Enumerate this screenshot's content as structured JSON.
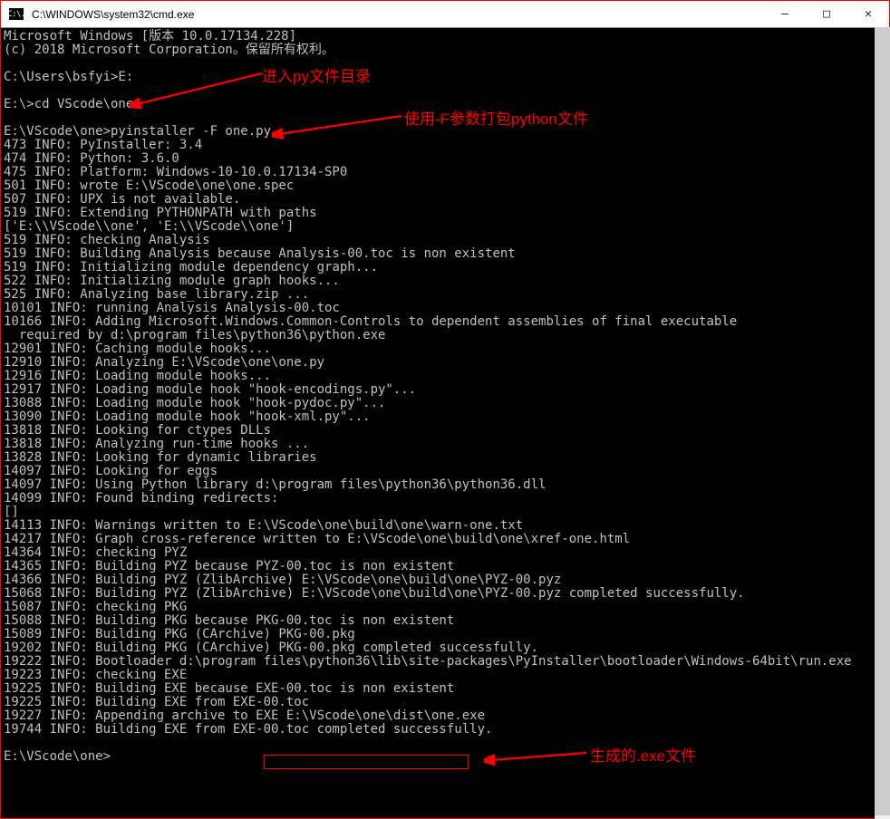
{
  "titlebar": {
    "icon_text": "C:\\.",
    "title": "C:\\WINDOWS\\system32\\cmd.exe"
  },
  "controls": {
    "minimize": "—",
    "maximize": "□",
    "close": "✕"
  },
  "terminal_lines": [
    "Microsoft Windows [版本 10.0.17134.228]",
    "(c) 2018 Microsoft Corporation。保留所有权利。",
    "",
    "C:\\Users\\bsfyi>E:",
    "",
    "E:\\>cd VScode\\one",
    "",
    "E:\\VScode\\one>pyinstaller -F one.py",
    "473 INFO: PyInstaller: 3.4",
    "474 INFO: Python: 3.6.0",
    "475 INFO: Platform: Windows-10-10.0.17134-SP0",
    "501 INFO: wrote E:\\VScode\\one\\one.spec",
    "507 INFO: UPX is not available.",
    "519 INFO: Extending PYTHONPATH with paths",
    "['E:\\\\VScode\\\\one', 'E:\\\\VScode\\\\one']",
    "519 INFO: checking Analysis",
    "519 INFO: Building Analysis because Analysis-00.toc is non existent",
    "519 INFO: Initializing module dependency graph...",
    "522 INFO: Initializing module graph hooks...",
    "525 INFO: Analyzing base_library.zip ...",
    "10101 INFO: running Analysis Analysis-00.toc",
    "10166 INFO: Adding Microsoft.Windows.Common-Controls to dependent assemblies of final executable",
    "  required by d:\\program files\\python36\\python.exe",
    "12901 INFO: Caching module hooks...",
    "12910 INFO: Analyzing E:\\VScode\\one\\one.py",
    "12916 INFO: Loading module hooks...",
    "12917 INFO: Loading module hook \"hook-encodings.py\"...",
    "13088 INFO: Loading module hook \"hook-pydoc.py\"...",
    "13090 INFO: Loading module hook \"hook-xml.py\"...",
    "13818 INFO: Looking for ctypes DLLs",
    "13818 INFO: Analyzing run-time hooks ...",
    "13828 INFO: Looking for dynamic libraries",
    "14097 INFO: Looking for eggs",
    "14097 INFO: Using Python library d:\\program files\\python36\\python36.dll",
    "14099 INFO: Found binding redirects:",
    "[]",
    "14113 INFO: Warnings written to E:\\VScode\\one\\build\\one\\warn-one.txt",
    "14217 INFO: Graph cross-reference written to E:\\VScode\\one\\build\\one\\xref-one.html",
    "14364 INFO: checking PYZ",
    "14365 INFO: Building PYZ because PYZ-00.toc is non existent",
    "14366 INFO: Building PYZ (ZlibArchive) E:\\VScode\\one\\build\\one\\PYZ-00.pyz",
    "15068 INFO: Building PYZ (ZlibArchive) E:\\VScode\\one\\build\\one\\PYZ-00.pyz completed successfully.",
    "15087 INFO: checking PKG",
    "15088 INFO: Building PKG because PKG-00.toc is non existent",
    "15089 INFO: Building PKG (CArchive) PKG-00.pkg",
    "19202 INFO: Building PKG (CArchive) PKG-00.pkg completed successfully.",
    "19222 INFO: Bootloader d:\\program files\\python36\\lib\\site-packages\\PyInstaller\\bootloader\\Windows-64bit\\run.exe",
    "19223 INFO: checking EXE",
    "19225 INFO: Building EXE because EXE-00.toc is non existent",
    "19225 INFO: Building EXE from EXE-00.toc",
    "19227 INFO: Appending archive to EXE E:\\VScode\\one\\dist\\one.exe",
    "19744 INFO: Building EXE from EXE-00.toc completed successfully.",
    "",
    "E:\\VScode\\one>"
  ],
  "annotations": {
    "a1": "进入py文件目录",
    "a2": "使用-F参数打包python文件",
    "a3": "生成的.exe文件"
  }
}
